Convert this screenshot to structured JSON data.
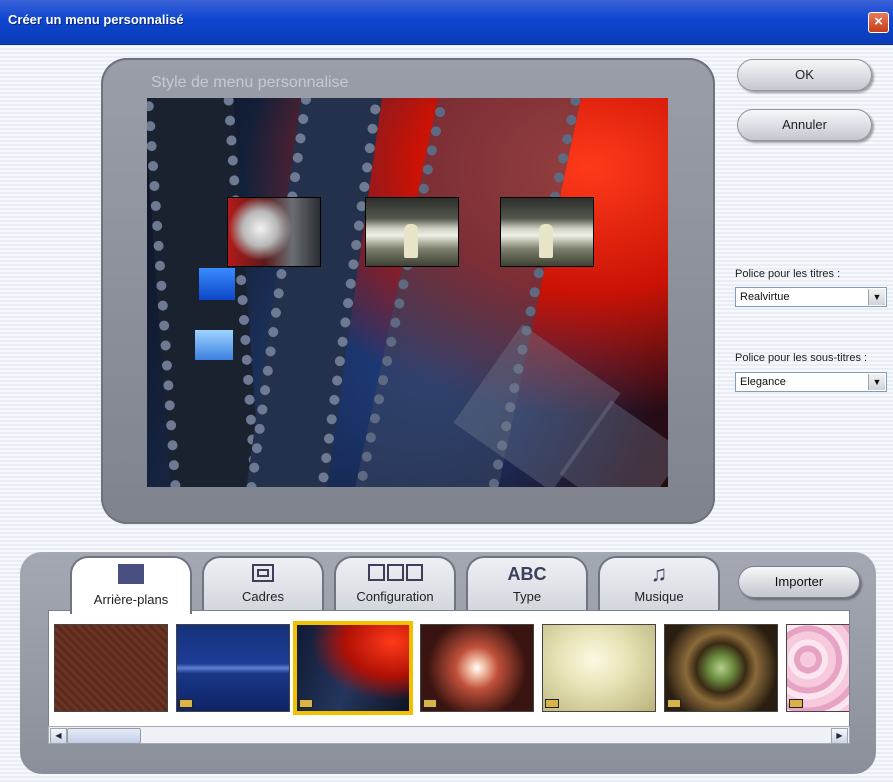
{
  "window": {
    "title": "Créer un menu personnalisé",
    "close_glyph": "×"
  },
  "preview": {
    "title": "Style de menu personnalise"
  },
  "buttons": {
    "ok": "OK",
    "cancel": "Annuler",
    "import": "Importer"
  },
  "fonts": {
    "title_label": "Police pour les titres :",
    "title_value": "Realvirtue",
    "subtitle_label": "Police pour les sous-titres :",
    "subtitle_value": "Elegance"
  },
  "tabs": [
    {
      "label": "Arrière-plans",
      "icon": "background-swatch-icon",
      "active": true
    },
    {
      "label": "Cadres",
      "icon": "frame-icon",
      "active": false
    },
    {
      "label": "Configuration",
      "icon": "layout-boxes-icon",
      "active": false
    },
    {
      "label": "Type",
      "icon": "abc-text-icon",
      "icon_text": "ABC",
      "active": false
    },
    {
      "label": "Musique",
      "icon": "music-note-icon",
      "icon_text": "♫",
      "active": false
    }
  ],
  "thumbnails": [
    {
      "name": "brick",
      "selected": false
    },
    {
      "name": "blue-panel",
      "selected": false
    },
    {
      "name": "film-strip",
      "selected": true
    },
    {
      "name": "fire-burst",
      "selected": false
    },
    {
      "name": "cream-cloud",
      "selected": false
    },
    {
      "name": "ornament",
      "selected": false
    },
    {
      "name": "pink-petals",
      "selected": false
    }
  ],
  "scroll": {
    "left_glyph": "◀",
    "right_glyph": "▶"
  },
  "select_arrow": "▼"
}
